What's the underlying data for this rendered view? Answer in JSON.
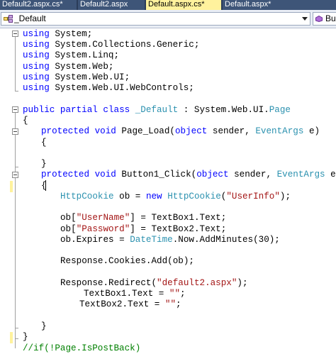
{
  "tabs": [
    {
      "label": "Default2.aspx.cs*"
    },
    {
      "label": "Default2.aspx"
    },
    {
      "label": "Default.aspx.cs*"
    },
    {
      "label": "Default.aspx*"
    }
  ],
  "nav": {
    "class_combo": "_Default",
    "member_combo": "Bu"
  },
  "code": {
    "l1": {
      "kw": "using",
      "rest": " System;"
    },
    "l2": {
      "kw": "using",
      "rest": " System.Collections.Generic;"
    },
    "l3": {
      "kw": "using",
      "rest": " System.Linq;"
    },
    "l4": {
      "kw": "using",
      "rest": " System.Web;"
    },
    "l5": {
      "kw": "using",
      "rest": " System.Web.UI;"
    },
    "l6": {
      "kw": "using",
      "rest": " System.Web.UI.WebControls;"
    },
    "l8": {
      "kw1": "public",
      "kw2": "partial",
      "kw3": "class",
      "type": "_Default",
      "rest1": " : System.Web.UI.",
      "type2": "Page"
    },
    "l9": {
      "text": "{"
    },
    "l10": {
      "kw1": "protected",
      "kw2": "void",
      "name": " Page_Load(",
      "kw3": "object",
      "mid": " sender, ",
      "type": "EventArgs",
      "end": " e)"
    },
    "l11": {
      "text": "{"
    },
    "l13": {
      "text": "}"
    },
    "l14": {
      "kw1": "protected",
      "kw2": "void",
      "name": " Button1_Click(",
      "kw3": "object",
      "mid": " sender, ",
      "type": "EventArgs",
      "end": " e)"
    },
    "l15": {
      "text": "{"
    },
    "l16": {
      "type": "HttpCookie",
      "mid": " ob = ",
      "kw": "new",
      "type2": "HttpCookie",
      "open": "(",
      "str": "\"UserInfo\"",
      "end": ");"
    },
    "l18": {
      "pre": "ob[",
      "str": "\"UserName\"",
      "end": "] = TextBox1.Text;"
    },
    "l19": {
      "pre": "ob[",
      "str": "\"Password\"",
      "end": "] = TextBox2.Text;"
    },
    "l20": {
      "pre": "ob.Expires = ",
      "type": "DateTime",
      "end": ".Now.AddMinutes(30);"
    },
    "l22": {
      "text": "Response.Cookies.Add(ob);"
    },
    "l24": {
      "pre": "Response.Redirect(",
      "str": "\"default2.aspx\"",
      "end": ");"
    },
    "l25": {
      "pre": "TextBox1.Text = ",
      "str": "\"\"",
      "end": ";"
    },
    "l26": {
      "pre": "TextBox2.Text = ",
      "str": "\"\"",
      "end": ";"
    },
    "l28": {
      "text": "}"
    },
    "l29": {
      "text": "}"
    },
    "l30": {
      "text": "//if(!Page.IsPostBack)"
    }
  },
  "colors": {
    "keyword": "#0000ff",
    "type": "#2b91af",
    "string": "#a31515",
    "changed_line_marker": "#fff29d",
    "tab_active": "#fff29d",
    "tab_inactive": "#3e5578",
    "tab_strip": "#2b3c59"
  },
  "icons": {
    "class_combo_icon": "class-icon",
    "member_combo_icon": "method-icon"
  }
}
